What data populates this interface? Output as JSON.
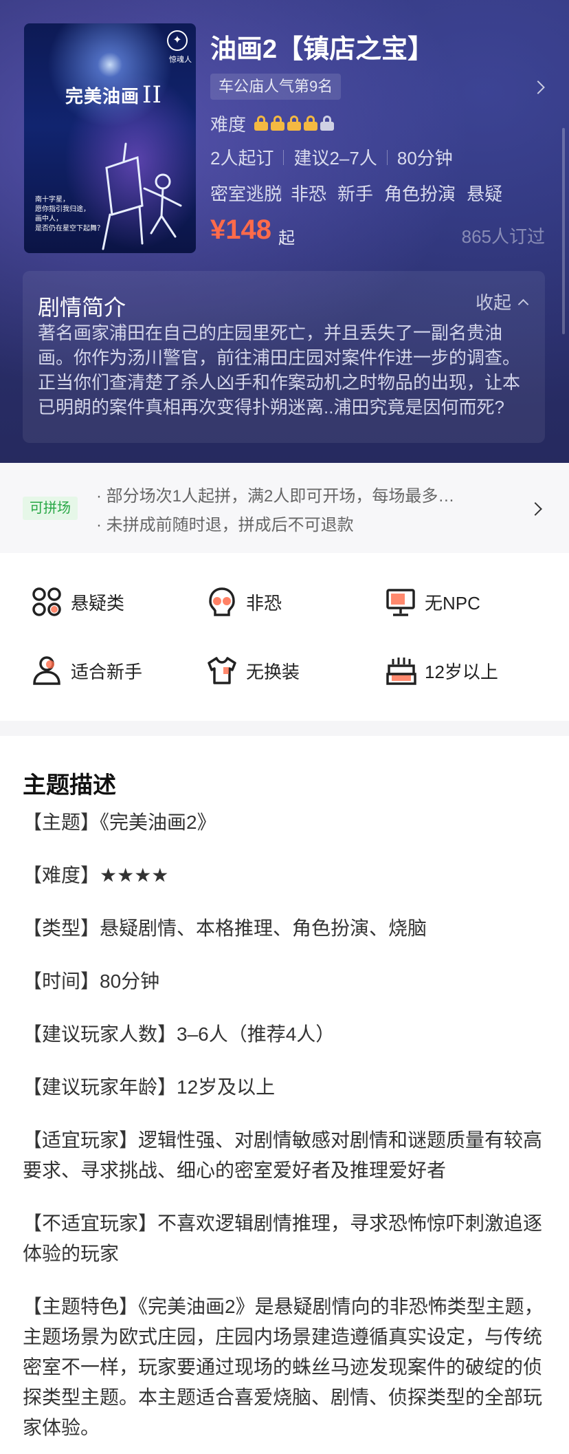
{
  "header": {
    "poster": {
      "title": "完美油画",
      "roman": "II",
      "logo_text": "惊魂人",
      "slogan": [
        "南十字星，",
        "愿你指引我归途，",
        "画中人，",
        "是否仍在星空下起舞？"
      ]
    },
    "title": "油画2【镇店之宝】",
    "rank": "车公庙人气第9名",
    "difficulty_label": "难度",
    "difficulty_level": 4,
    "difficulty_max": 5,
    "meta": [
      "2人起订",
      "建议2–7人",
      "80分钟"
    ],
    "tags": [
      "密室逃脱",
      "非恐",
      "新手",
      "角色扮演",
      "悬疑"
    ],
    "price": "¥148",
    "price_suffix": "起",
    "booked": "865人订过"
  },
  "story": {
    "title": "剧情简介",
    "toggle": "收起",
    "text": "著名画家浦田在自己的庄园里死亡，并且丢失了一副名贵油画。你作为汤川警官，前往浦田庄园对案件作进一步的调查。正当你们查清楚了杀人凶手和作案动机之时物品的出现，让本已明朗的案件真相再次变得扑朔迷离..浦田究竟是因何而死?"
  },
  "pool": {
    "badge": "可拼场",
    "lines": [
      "· 部分场次1人起拼，满2人即可开场，每场最多…",
      "· 未拼成前随时退，拼成后不可退款"
    ]
  },
  "features": [
    {
      "label": "悬疑类",
      "icon": "puzzle-icon"
    },
    {
      "label": "非恐",
      "icon": "skull-icon"
    },
    {
      "label": "无NPC",
      "icon": "monitor-icon"
    },
    {
      "label": "适合新手",
      "icon": "person-icon"
    },
    {
      "label": "无换装",
      "icon": "shirt-icon"
    },
    {
      "label": "12岁以上",
      "icon": "cake-icon"
    }
  ],
  "description": {
    "title": "主题描述",
    "paragraphs": [
      "【主题】《完美油画2》",
      "【难度】★★★★",
      "【类型】悬疑剧情、本格推理、角色扮演、烧脑",
      "【时间】80分钟",
      "【建议玩家人数】3–6人（推荐4人）",
      "【建议玩家年龄】12岁及以上",
      "【适宜玩家】逻辑性强、对剧情敏感对剧情和谜题质量有较高要求、寻求挑战、细心的密室爱好者及推理爱好者",
      "【不适宜玩家】不喜欢逻辑剧情推理，寻求恐怖惊吓刺激追逐体验的玩家",
      "【主题特色】《完美油画2》是悬疑剧情向的非恐怖类型主题，主题场景为欧式庄园，庄园内场景建造遵循真实设定，与传统密室不一样，玩家要通过现场的蛛丝马迹发现案件的破绽的侦探类型主题。本主题适合喜爱烧脑、剧情、侦探类型的全部玩家体验。"
    ]
  },
  "colors": {
    "price": "#ff6b4a",
    "lock_on": "#f4b942",
    "lock_off": "#cfd1e4",
    "pool_badge": "#27a745",
    "icon_accent": "#ff6b4a"
  }
}
